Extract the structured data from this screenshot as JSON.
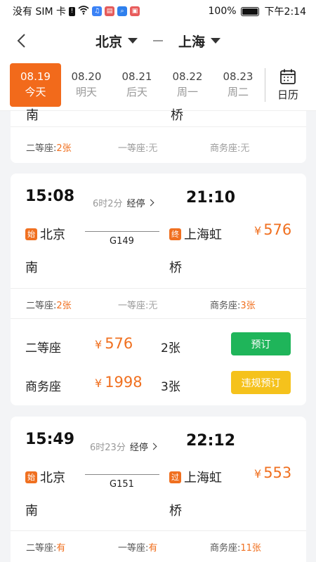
{
  "status_bar": {
    "carrier": "没有 SIM 卡",
    "battery": "100%",
    "time": "下午2:14",
    "colors": {
      "icon1": "#3b82f6",
      "icon2": "#e55b5b",
      "icon3": "#2f80ed",
      "icon4": "#e85c5c"
    }
  },
  "nav": {
    "from": "北京",
    "to": "上海"
  },
  "dates": [
    {
      "date": "08.19",
      "label": "今天",
      "active": true
    },
    {
      "date": "08.20",
      "label": "明天",
      "active": false
    },
    {
      "date": "08.21",
      "label": "后天",
      "active": false
    },
    {
      "date": "08.22",
      "label": "周一",
      "active": false
    },
    {
      "date": "08.23",
      "label": "周二",
      "active": false
    }
  ],
  "calendar_label": "日历",
  "top_partial": {
    "dep_station_tail": "南",
    "arr_station_tail": "桥",
    "seats": [
      {
        "name": "二等座:",
        "value": "2张",
        "style": "orange"
      },
      {
        "name": "一等座:",
        "value": "无",
        "style": "gray"
      },
      {
        "name": "商务座:",
        "value": "无",
        "style": "gray"
      }
    ]
  },
  "trains": [
    {
      "dep_time": "15:08",
      "arr_time": "21:10",
      "duration": "6时2分",
      "via": "经停",
      "dep_tag": "始",
      "dep_station_1": "北京",
      "dep_station_2": "南",
      "arr_tag": "终",
      "arr_station_1": "上海虹",
      "arr_station_2": "桥",
      "train_no": "G149",
      "yen": "¥",
      "price": "576",
      "seats": [
        {
          "name": "二等座:",
          "value": "2张",
          "style": "orange"
        },
        {
          "name": "一等座:",
          "value": "无",
          "style": "gray"
        },
        {
          "name": "商务座:",
          "value": "3张",
          "style": "orange"
        }
      ],
      "details": [
        {
          "name": "二等座",
          "yen": "¥",
          "price": "576",
          "count": "2张",
          "button": "预订",
          "button_color": "#1fb55a"
        },
        {
          "name": "商务座",
          "yen": "¥",
          "price": "1998",
          "count": "3张",
          "button": "违规预订",
          "button_color": "#f5c21c"
        }
      ]
    },
    {
      "dep_time": "15:49",
      "arr_time": "22:12",
      "duration": "6时23分",
      "via": "经停",
      "dep_tag": "始",
      "dep_station_1": "北京",
      "dep_station_2": "南",
      "arr_tag": "过",
      "arr_station_1": "上海虹",
      "arr_station_2": "桥",
      "train_no": "G151",
      "yen": "¥",
      "price": "553",
      "seats": [
        {
          "name": "二等座:",
          "value": "有",
          "style": "orange"
        },
        {
          "name": "一等座:",
          "value": "有",
          "style": "orange"
        },
        {
          "name": "商务座:",
          "value": "11张",
          "style": "orange"
        }
      ]
    }
  ],
  "accent": "#f26a1b"
}
